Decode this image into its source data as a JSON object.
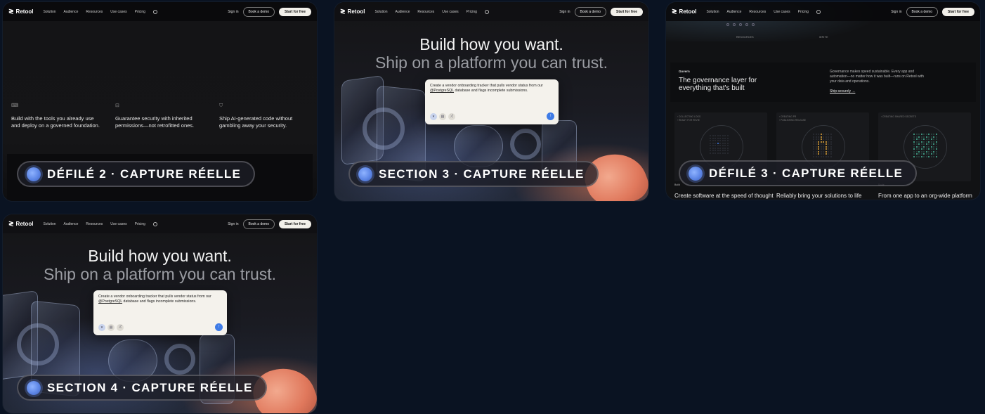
{
  "nav": {
    "logo": "Retool",
    "links": [
      "Solution",
      "Audience",
      "Resources",
      "Use cases",
      "Pricing"
    ],
    "signin": "Sign in",
    "demo": "Book a demo",
    "free": "Start for free"
  },
  "panel1": {
    "features": [
      "Build with the tools you already use and deploy on a governed foundation.",
      "Guarantee security with inherited permissions—not retrofitted ones.",
      "Ship AI-generated code without gambling away your security."
    ],
    "caption": "DÉFILÉ 2 · CAPTURE RÉELLE"
  },
  "hero": {
    "line1": "Build how you want.",
    "line2": "Ship on a platform you can trust.",
    "prompt_before": "Create a vendor onboarding tracker that pulls vendor status from our ",
    "prompt_mention": "@PostgreSQL",
    "prompt_after": " database and flags incomplete submissions."
  },
  "panel2": {
    "caption": "SECTION 3 · CAPTURE RÉELLE"
  },
  "panel3": {
    "top_labels": [
      "RESOURCES",
      "WRITE"
    ],
    "gov_tag": "Govern",
    "gov_title": "The governance layer for everything that's built",
    "gov_desc": "Governance makes speed sustainable. Every app and automation—no matter how it was built—runs on Retool with your data and operations.",
    "gov_link": "Ship securely →",
    "cards": [
      {
        "label1": "› COLLECTING LOGS",
        "label2": "› READY FOR REVIE"
      },
      {
        "label1": "› CREATING PR",
        "label2": "› PUBLISHING RELEASE"
      },
      {
        "label1": "› CREATING SHARED SECRETS",
        "label2": ""
      }
    ],
    "footer": [
      {
        "tag": "Build",
        "title": "Create software at the speed of thought"
      },
      {
        "tag": "",
        "title": "Reliably bring your solutions to life"
      },
      {
        "tag": "Scale",
        "title": "From one app to an org-wide platform"
      }
    ],
    "caption": "DÉFILÉ 3 · CAPTURE RÉELLE"
  },
  "panel4": {
    "caption": "SECTION 4 · CAPTURE RÉELLE"
  },
  "colors": {
    "accent_blue": "#3e7be6",
    "pill_dot": "#5d86e6",
    "hand": "#e0785c",
    "gold": "#e6a73a",
    "teal": "#49b89a"
  }
}
